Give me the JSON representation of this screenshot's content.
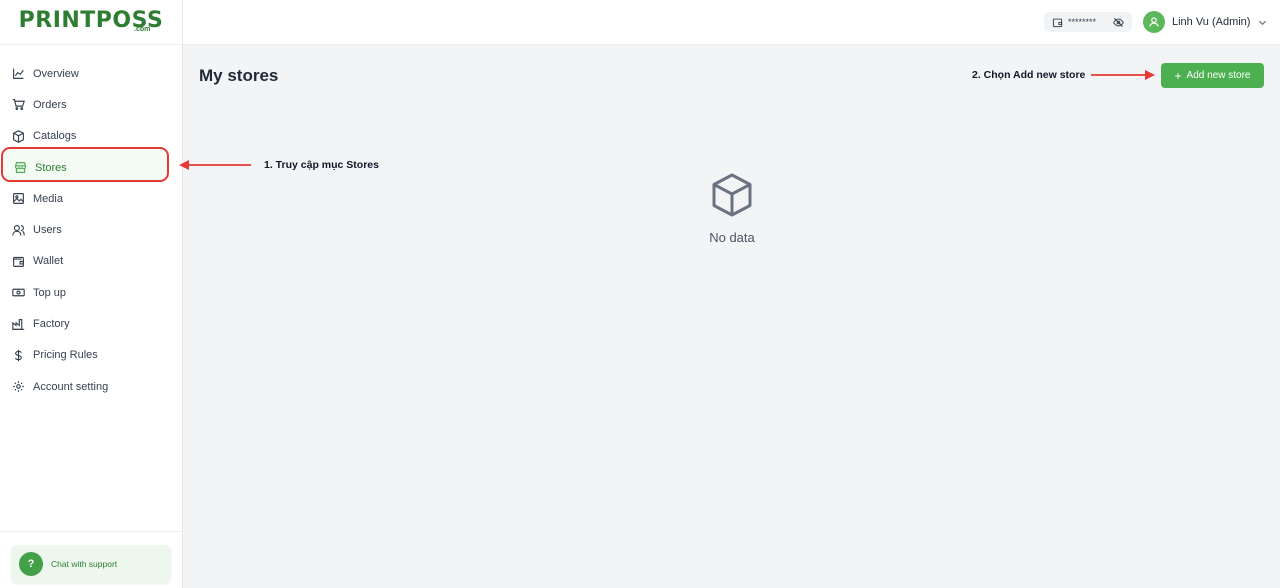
{
  "brand": {
    "name": "PRINTPOSS",
    "suffix": ".com"
  },
  "sidebar": {
    "items": [
      {
        "label": "Overview",
        "icon": "chart-line-icon"
      },
      {
        "label": "Orders",
        "icon": "cart-icon"
      },
      {
        "label": "Catalogs",
        "icon": "box-icon"
      },
      {
        "label": "Stores",
        "icon": "store-icon",
        "active": true
      },
      {
        "label": "Media",
        "icon": "image-icon"
      },
      {
        "label": "Users",
        "icon": "users-icon"
      },
      {
        "label": "Wallet",
        "icon": "wallet-icon"
      },
      {
        "label": "Top up",
        "icon": "cash-icon"
      },
      {
        "label": "Factory",
        "icon": "factory-icon"
      },
      {
        "label": "Pricing Rules",
        "icon": "dollar-icon"
      },
      {
        "label": "Account setting",
        "icon": "gear-icon"
      }
    ],
    "chat": {
      "badge": "?",
      "label": "Chat with support"
    }
  },
  "header": {
    "wallet_masked": "********",
    "user_name": "Linh Vu (Admin)"
  },
  "main": {
    "title": "My stores",
    "add_button": "Add new store",
    "add_button_icon": "+",
    "empty_text": "No data"
  },
  "annotations": {
    "step1": "1. Truy cập mục Stores",
    "step2": "2. Chọn Add new store"
  },
  "colors": {
    "brand_green": "#2e7d32",
    "button_green": "#4caf50",
    "highlight_red": "#e53935"
  }
}
